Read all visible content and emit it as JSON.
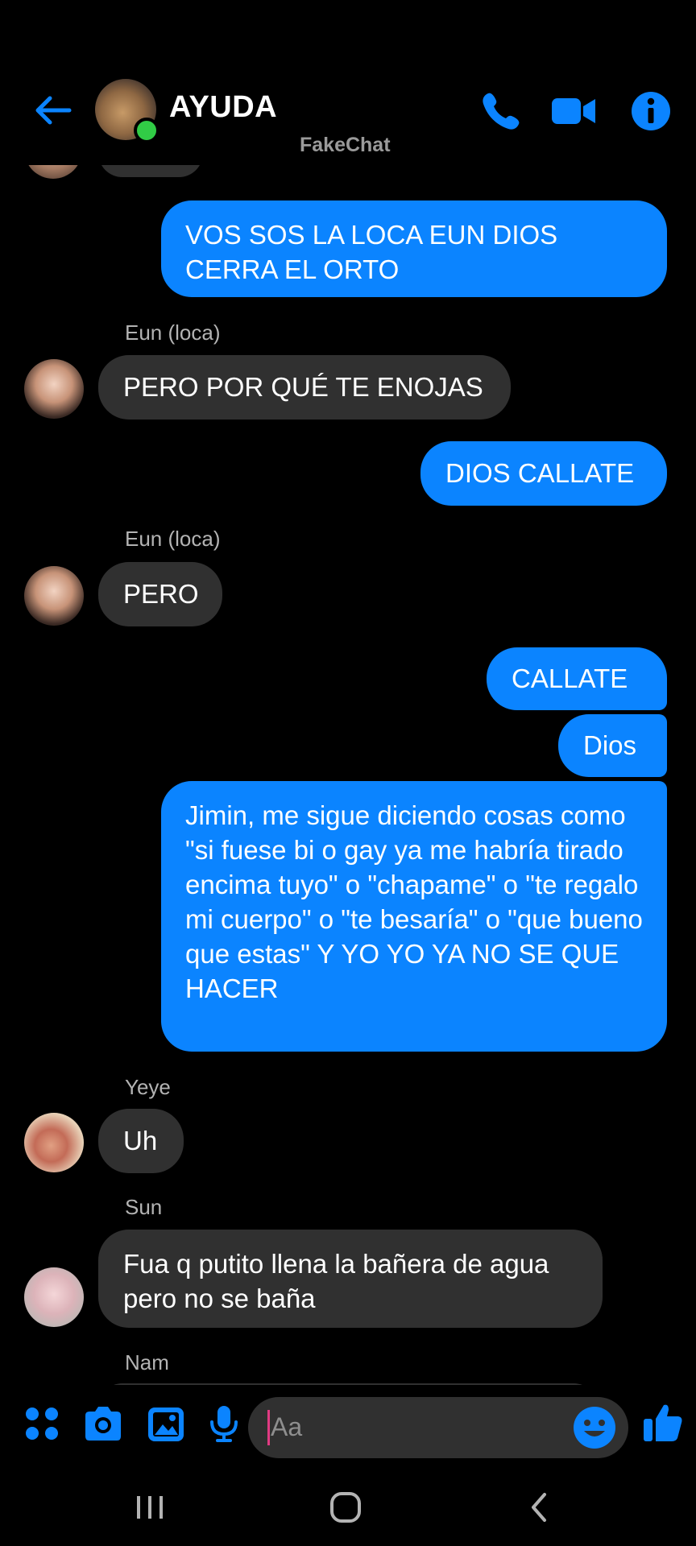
{
  "header": {
    "title": "AYUDA",
    "watermark": "FakeChat",
    "icons": [
      "back-arrow-icon",
      "phone-icon",
      "video-icon",
      "info-icon"
    ],
    "accent_color": "#0b84ff",
    "online_color": "#31cc46"
  },
  "messages": [
    {
      "side": "out",
      "text": "VOS SOS LA LOCA EUN DIOS CERRA EL ORTO"
    },
    {
      "side": "in",
      "sender": "Eun (loca)",
      "text": "PERO POR QUÉ TE ENOJAS"
    },
    {
      "side": "out",
      "text": "DIOS CALLATE"
    },
    {
      "side": "in",
      "sender": "Eun (loca)",
      "text": "PERO"
    },
    {
      "side": "out",
      "text": "CALLATE"
    },
    {
      "side": "out",
      "text": "Dios"
    },
    {
      "side": "out",
      "text": "Jimin, me sigue diciendo cosas como \"si fuese bi o gay ya me habría tirado encima tuyo\" o \"chapame\" o \"te regalo mi cuerpo\" o \"te besaría\" o \"que bueno que estas\" Y YO YO YA NO SE QUE HACER"
    },
    {
      "side": "in",
      "sender": "Yeye",
      "text": "Uh"
    },
    {
      "side": "in",
      "sender": "Sun",
      "text": "Fua q putito llena la bañera de agua pero no se baña"
    },
    {
      "side": "in",
      "sender": "Nam",
      "text": ""
    }
  ],
  "composer": {
    "placeholder": "Aa",
    "icons": [
      "apps-grid-icon",
      "camera-icon",
      "gallery-icon",
      "microphone-icon",
      "emoji-icon",
      "thumbs-up-icon"
    ]
  },
  "navbar": {
    "icons": [
      "recent-apps-icon",
      "home-icon",
      "back-icon"
    ]
  },
  "colors": {
    "outgoing_bubble": "#0b84ff",
    "incoming_bubble": "#303030",
    "background": "#000000"
  }
}
